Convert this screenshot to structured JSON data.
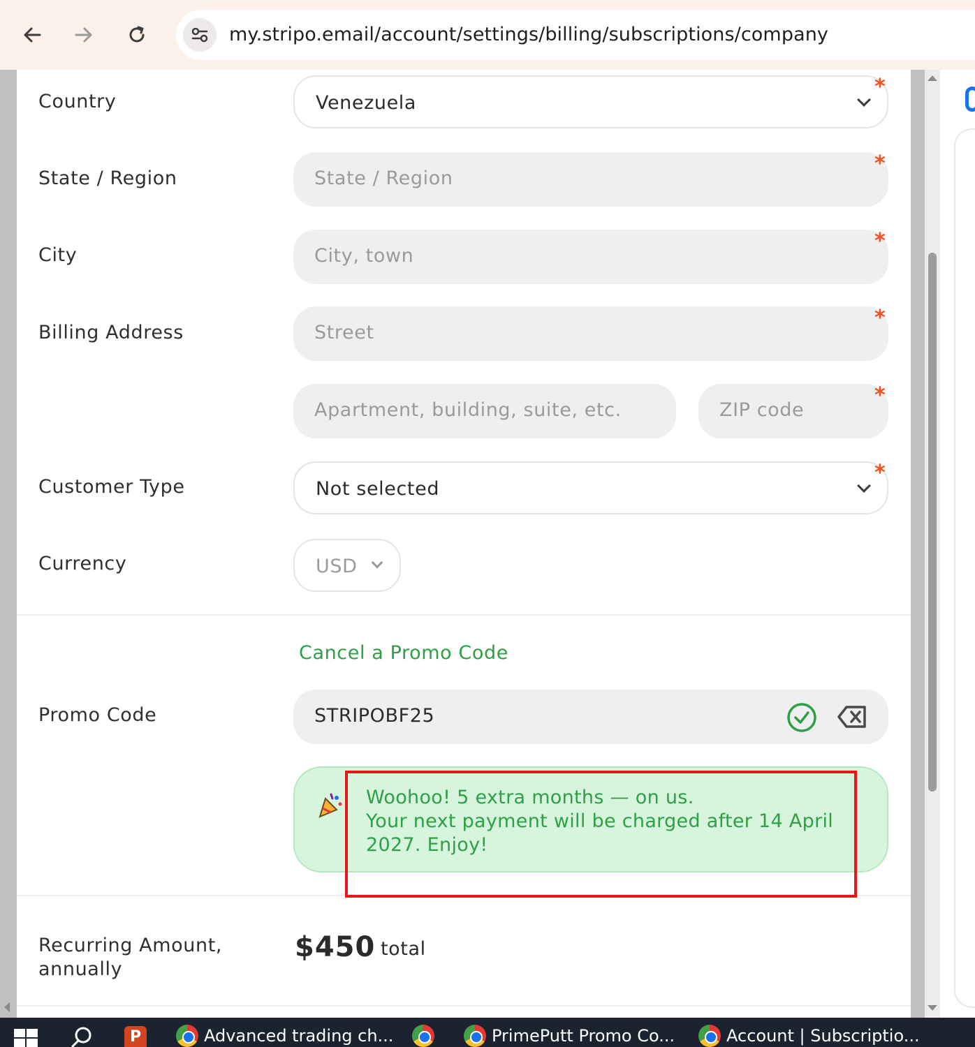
{
  "browser": {
    "url": "my.stripo.email/account/settings/billing/subscriptions/company"
  },
  "form": {
    "country": {
      "label": "Country",
      "value": "Venezuela"
    },
    "state": {
      "label": "State / Region",
      "placeholder": "State / Region"
    },
    "city": {
      "label": "City",
      "placeholder": "City, town"
    },
    "billing_address": {
      "label": "Billing Address",
      "street_placeholder": "Street",
      "apartment_placeholder": "Apartment, building, suite, etc.",
      "zip_placeholder": "ZIP code"
    },
    "customer_type": {
      "label": "Customer Type",
      "value": "Not selected"
    },
    "currency": {
      "label": "Currency",
      "value": "USD"
    },
    "required_mark": "*"
  },
  "promo": {
    "cancel_link": "Cancel a Promo Code",
    "label": "Promo Code",
    "code": "STRIPOBF25",
    "message_line1": "Woohoo! 5 extra months — on us.",
    "message_line2": "Your next payment will be charged after 14 April 2027. Enjoy!"
  },
  "recurring": {
    "label_line1": "Recurring Amount,",
    "label_line2": "annually",
    "amount": "$450",
    "unit": "total"
  },
  "taskbar": {
    "items": [
      {
        "label": "Advanced trading ch..."
      },
      {
        "label": "PrimePutt Promo Co..."
      },
      {
        "label": "Account | Subscriptio..."
      }
    ]
  },
  "colors": {
    "accent_green": "#2ca043",
    "required_red": "#f4511e",
    "highlight_red": "#e8151b",
    "success_bg": "#d7f5dd"
  }
}
